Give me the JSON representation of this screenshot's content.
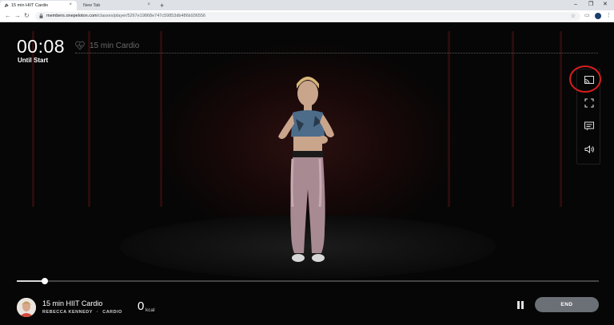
{
  "browser": {
    "tabs": [
      {
        "title": "15 min HIIT Cardio",
        "active": true
      },
      {
        "title": "New Tab",
        "active": false
      }
    ],
    "new_tab_symbol": "+",
    "close_symbol": "×",
    "url_host": "members.onepeloton.com",
    "url_path": "/classes/player/5267e19868e747c59853db486b936556",
    "window_controls": {
      "minimize": "–",
      "maximize": "❐",
      "close": "✕"
    }
  },
  "player": {
    "countdown": "00:08",
    "countdown_label": "Until Start",
    "class_title": "15 min Cardio",
    "progress_fraction": 0.048,
    "controls": [
      "cast-icon",
      "fullscreen-icon",
      "captions-icon",
      "volume-icon"
    ],
    "cast_highlight_color": "#d81e1e"
  },
  "footer": {
    "class_name": "15 min HIIT Cardio",
    "instructor": "REBECCA KENNEDY",
    "separator": "·",
    "discipline": "CARDIO",
    "kcal_value": "0",
    "kcal_unit": "kcal",
    "end_label": "END"
  }
}
